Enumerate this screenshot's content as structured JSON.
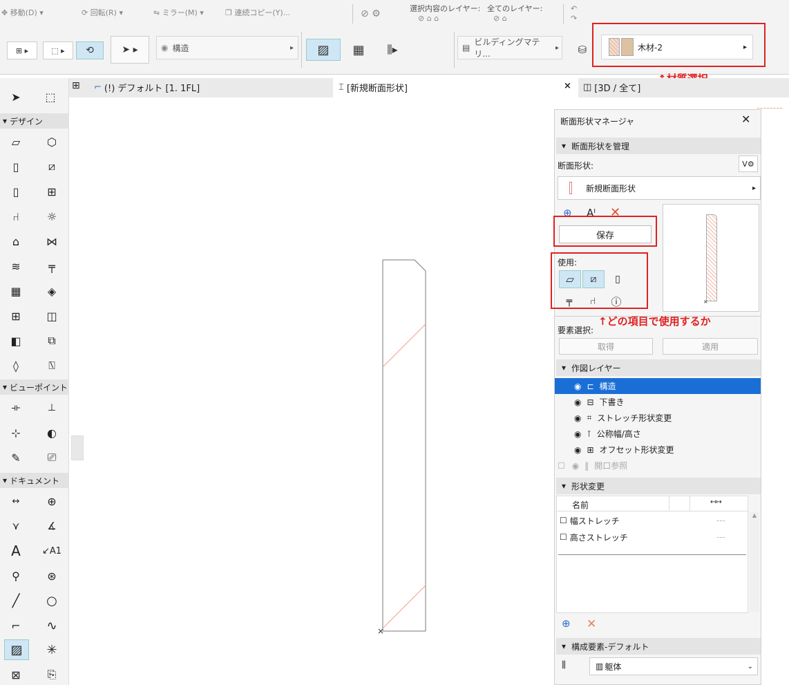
{
  "toolbar": {
    "move": "移動(D)",
    "rotate": "回転(R)",
    "mirror": "ミラー(M)",
    "multiply": "連続コピー(Y)...",
    "sel_layer": "選択内容のレイヤー:",
    "all_layers": "全てのレイヤー:",
    "layer_field": "構造",
    "building_material": "ビルディングマテリ...",
    "surface": "木材-2"
  },
  "annotations": {
    "material": "↑材質選択",
    "usage": "↑どの項目で使用するか"
  },
  "tabs": {
    "floor": "(!) デフォルト [1. 1FL]",
    "profile": "[新規断面形状]",
    "view3d": "[3D / 全て]"
  },
  "sidebar": {
    "design": "デザイン",
    "viewpoint": "ビューポイント",
    "document": "ドキュメント"
  },
  "panel": {
    "title": "断面形状マネージャ",
    "manage": "断面形状を管理",
    "profile_label": "断面形状:",
    "profile_name": "新規断面形状",
    "save": "保存",
    "usage_label": "使用:",
    "element_select": "要素選択:",
    "get": "取得",
    "apply": "適用",
    "drawing_layers": "作図レイヤー",
    "layers": [
      {
        "name": "構造"
      },
      {
        "name": "下書き"
      },
      {
        "name": "ストレッチ形状変更"
      },
      {
        "name": "公称幅/高さ"
      },
      {
        "name": "オフセット形状変更"
      },
      {
        "name": "開口参照"
      }
    ],
    "modifiers": "形状変更",
    "col_name": "名前",
    "mod_rows": [
      {
        "name": "幅ストレッチ",
        "value": "---"
      },
      {
        "name": "高さストレッチ",
        "value": "---"
      }
    ],
    "component_default": "構成要素-デフォルト",
    "component": "躯体"
  }
}
